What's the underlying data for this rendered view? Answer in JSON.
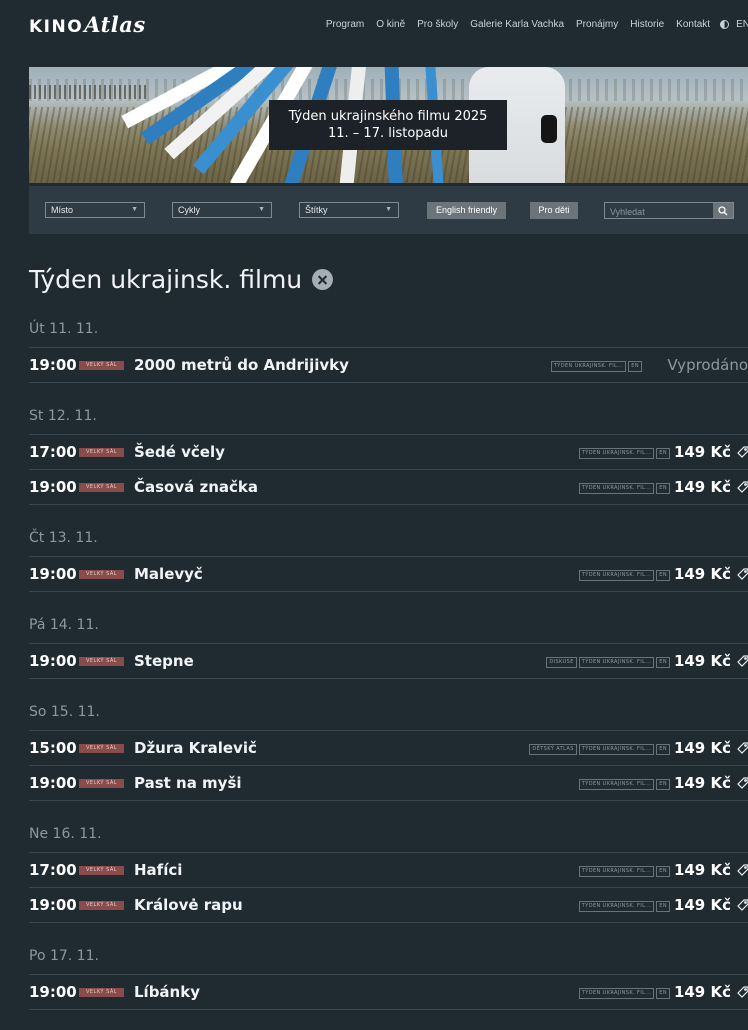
{
  "header": {
    "logo_kino": "KINO",
    "logo_atlas": "Atlas",
    "nav": [
      "Program",
      "O kině",
      "Pro školy",
      "Galerie Karla Vachka",
      "Pronájmy",
      "Historie",
      "Kontakt"
    ],
    "lang": "EN"
  },
  "banner": {
    "line1": "Týden ukrajinského filmu 2025",
    "line2": "11. – 17. listopadu"
  },
  "filters": {
    "place": "Místo",
    "cycles": "Cykly",
    "tags": "Štítky",
    "english_friendly": "English friendly",
    "for_kids": "Pro děti",
    "search_placeholder": "Vyhledat"
  },
  "page_title": "Týden ukrajinsk. filmu",
  "days": [
    {
      "date": "Út 11. 11.",
      "screenings": [
        {
          "time": "19:00",
          "hall": "VELKÝ SÁL",
          "film": "2000 metrů do Andrijivky",
          "tags": [
            "TÝDEN UKRAJINSK. FIL...",
            "EN"
          ],
          "status": "Vyprodáno"
        }
      ]
    },
    {
      "date": "St 12. 11.",
      "screenings": [
        {
          "time": "17:00",
          "hall": "VELKÝ SÁL",
          "film": "Šedé včely",
          "tags": [
            "TÝDEN UKRAJINSK. FIL...",
            "EN"
          ],
          "price": "149 Kč"
        },
        {
          "time": "19:00",
          "hall": "VELKÝ SÁL",
          "film": "Časová značka",
          "tags": [
            "TÝDEN UKRAJINSK. FIL...",
            "EN"
          ],
          "price": "149 Kč"
        }
      ]
    },
    {
      "date": "Čt 13. 11.",
      "screenings": [
        {
          "time": "19:00",
          "hall": "VELKÝ SÁL",
          "film": "Malevyč",
          "tags": [
            "TÝDEN UKRAJINSK. FIL...",
            "EN"
          ],
          "price": "149 Kč"
        }
      ]
    },
    {
      "date": "Pá 14. 11.",
      "screenings": [
        {
          "time": "19:00",
          "hall": "VELKÝ SÁL",
          "film": "Stepne",
          "tags": [
            "DISKUSE",
            "TÝDEN UKRAJINSK. FIL...",
            "EN"
          ],
          "price": "149 Kč"
        }
      ]
    },
    {
      "date": "So 15. 11.",
      "screenings": [
        {
          "time": "15:00",
          "hall": "VELKÝ SÁL",
          "film": "Džura Kralevič",
          "tags": [
            "DĚTSKÝ ATLAS",
            "TÝDEN UKRAJINSK. FIL...",
            "EN"
          ],
          "price": "149 Kč"
        },
        {
          "time": "19:00",
          "hall": "VELKÝ SÁL",
          "film": "Past na myši",
          "tags": [
            "TÝDEN UKRAJINSK. FIL...",
            "EN"
          ],
          "price": "149 Kč"
        }
      ]
    },
    {
      "date": "Ne 16. 11.",
      "screenings": [
        {
          "time": "17:00",
          "hall": "VELKÝ SÁL",
          "film": "Hafíci",
          "tags": [
            "TÝDEN UKRAJINSK. FIL...",
            "EN"
          ],
          "price": "149 Kč"
        },
        {
          "time": "19:00",
          "hall": "VELKÝ SÁL",
          "film": "Královė rapu",
          "tags": [
            "TÝDEN UKRAJINSK. FIL...",
            "EN"
          ],
          "price": "149 Kč"
        }
      ]
    },
    {
      "date": "Po 17. 11.",
      "screenings": [
        {
          "time": "19:00",
          "hall": "VELKÝ SÁL",
          "film": "Líbánky",
          "tags": [
            "TÝDEN UKRAJINSK. FIL...",
            "EN"
          ],
          "price": "149 Kč"
        }
      ]
    }
  ],
  "icons": {
    "contrast": "contrast-icon",
    "search": "search-icon",
    "clear": "clear-filter-icon",
    "ticket": "ticket-icon",
    "dropdown": "chevron-down-icon"
  }
}
